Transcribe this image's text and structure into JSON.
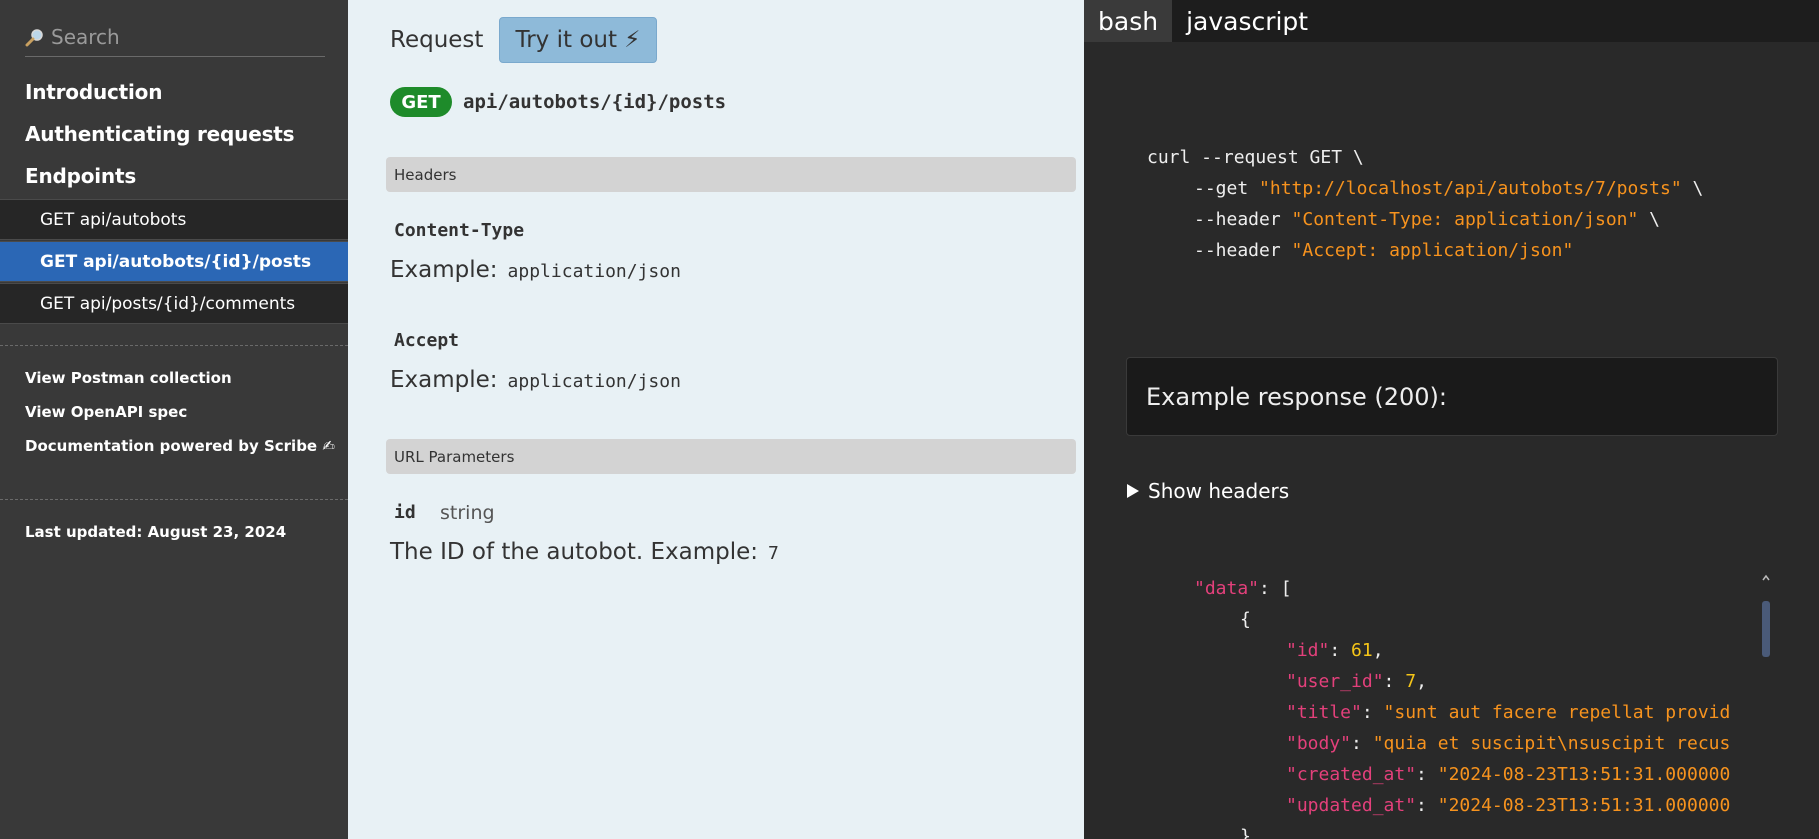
{
  "sidebar": {
    "search_placeholder": "Search",
    "toc": [
      {
        "label": "Introduction"
      },
      {
        "label": "Authenticating requests"
      },
      {
        "label": "Endpoints"
      }
    ],
    "endpoints": [
      {
        "label": "GET api/autobots",
        "active": false
      },
      {
        "label": "GET api/autobots/{id}/posts",
        "active": true
      },
      {
        "label": "GET api/posts/{id}/comments",
        "active": false
      }
    ],
    "links": [
      {
        "label": "View Postman collection"
      },
      {
        "label": "View OpenAPI spec"
      },
      {
        "label": "Documentation powered by Scribe ✍"
      }
    ],
    "last_updated": "Last updated: August 23, 2024"
  },
  "main": {
    "request_title": "Request",
    "try_button": "Try it out ⚡",
    "method": "GET",
    "endpoint": "api/autobots/{id}/posts",
    "headers_title": "Headers",
    "headers": [
      {
        "name": "Content-Type",
        "example_label": "Example:",
        "example": "application/json"
      },
      {
        "name": "Accept",
        "example_label": "Example:",
        "example": "application/json"
      }
    ],
    "url_params_title": "URL Parameters",
    "url_params": [
      {
        "name": "id",
        "type": "string",
        "description": "The ID of the autobot. Example:",
        "example": "7"
      }
    ]
  },
  "code_panel": {
    "tabs": [
      {
        "label": "bash",
        "active": true
      },
      {
        "label": "javascript",
        "active": false
      }
    ],
    "curl": {
      "line1": "curl --request GET \\",
      "get_flag": "--get ",
      "url": "\"http://localhost/api/autobots/7/posts\"",
      "header_flag": "--header ",
      "header1": "\"Content-Type: application/json\"",
      "header2": "\"Accept: application/json\"",
      "cont": " \\"
    },
    "response_title": "Example response (200):",
    "show_headers": "Show headers",
    "json": {
      "data_key": "\"data\"",
      "open_bracket": ": [",
      "open_brace": "{",
      "fields": [
        {
          "key": "\"id\"",
          "value": "61",
          "type": "num"
        },
        {
          "key": "\"user_id\"",
          "value": "7",
          "type": "num"
        },
        {
          "key": "\"title\"",
          "value": "\"sunt aut facere repellat provid",
          "type": "str"
        },
        {
          "key": "\"body\"",
          "value": "\"quia et suscipit\\nsuscipit recus",
          "type": "str"
        },
        {
          "key": "\"created_at\"",
          "value": "\"2024-08-23T13:51:31.000000",
          "type": "str"
        },
        {
          "key": "\"updated_at\"",
          "value": "\"2024-08-23T13:51:31.000000",
          "type": "str"
        }
      ],
      "close_brace": "},"
    }
  }
}
